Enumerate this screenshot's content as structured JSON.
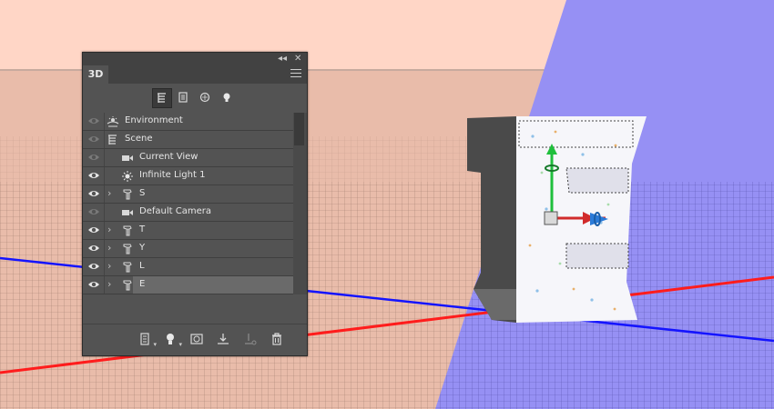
{
  "panel": {
    "tab_label": "3D",
    "collapse_icon": "double-chevron-left-icon",
    "close_icon": "close-icon",
    "menu_icon": "panel-menu-icon",
    "filters": [
      {
        "icon": "scene-filter-icon",
        "active": true
      },
      {
        "icon": "meshes-filter-icon",
        "active": false
      },
      {
        "icon": "materials-filter-icon",
        "active": false
      },
      {
        "icon": "lights-filter-icon",
        "active": false
      }
    ],
    "rows": [
      {
        "label": "Environment",
        "icon": "environment-icon",
        "visible": false,
        "indent": 0,
        "expandable": false
      },
      {
        "label": "Scene",
        "icon": "scene-icon",
        "visible": false,
        "indent": 0,
        "expandable": false
      },
      {
        "label": "Current View",
        "icon": "camera-icon",
        "visible": false,
        "indent": 1,
        "expandable": false
      },
      {
        "label": "Infinite Light 1",
        "icon": "light-icon",
        "visible": true,
        "indent": 1,
        "expandable": false
      },
      {
        "label": "S",
        "icon": "mesh-icon",
        "visible": true,
        "indent": 1,
        "expandable": true
      },
      {
        "label": "Default Camera",
        "icon": "camera-icon",
        "visible": false,
        "indent": 1,
        "expandable": false
      },
      {
        "label": "T",
        "icon": "mesh-icon",
        "visible": true,
        "indent": 1,
        "expandable": true
      },
      {
        "label": "Y",
        "icon": "mesh-icon",
        "visible": true,
        "indent": 1,
        "expandable": true
      },
      {
        "label": "L",
        "icon": "mesh-icon",
        "visible": true,
        "indent": 1,
        "expandable": true
      },
      {
        "label": "E",
        "icon": "mesh-icon",
        "visible": true,
        "indent": 1,
        "expandable": true,
        "selected": true
      }
    ],
    "bottom_buttons": [
      {
        "icon": "new-mesh-icon",
        "has_menu": true
      },
      {
        "icon": "new-light-icon",
        "has_menu": true
      },
      {
        "icon": "material-drop-icon",
        "has_menu": false
      },
      {
        "icon": "ground-plane-icon",
        "has_menu": false
      },
      {
        "icon": "render-icon",
        "has_menu": false
      },
      {
        "icon": "trash-icon",
        "has_menu": false
      }
    ]
  },
  "colors": {
    "background_salmon": "#ffd6c6",
    "background_violet": "#9690f4",
    "x_axis": "#ff1c1c",
    "z_axis": "#1414ff",
    "gizmo_green": "#1fbf3c",
    "gizmo_red": "#d12b2b",
    "gizmo_blue": "#2a7ad8"
  }
}
